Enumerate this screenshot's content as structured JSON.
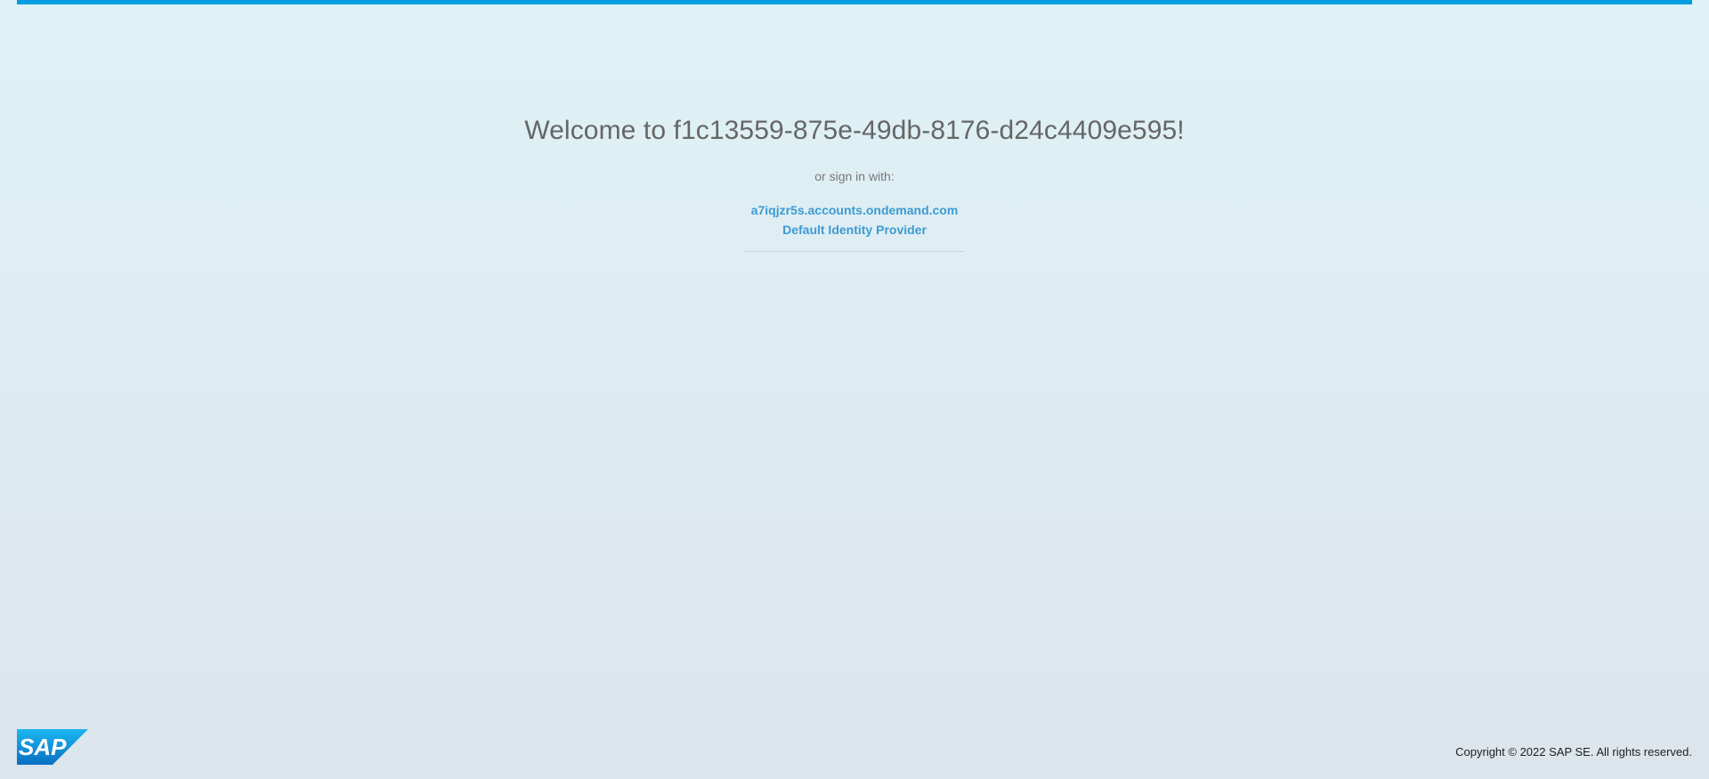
{
  "header": {
    "accent_color": "#009de0"
  },
  "main": {
    "welcome_title": "Welcome to f1c13559-875e-49db-8176-d24c4409e595!",
    "signin_hint": "or sign in with:",
    "identity_providers": [
      {
        "label": "a7iqjzr5s.accounts.ondemand.com"
      },
      {
        "label": "Default Identity Provider"
      }
    ],
    "link_color": "#3d9bd1"
  },
  "footer": {
    "logo_text": "SAP",
    "logo_icon": "sap-logo-icon",
    "copyright": "Copyright © 2022 SAP SE. All rights reserved."
  }
}
